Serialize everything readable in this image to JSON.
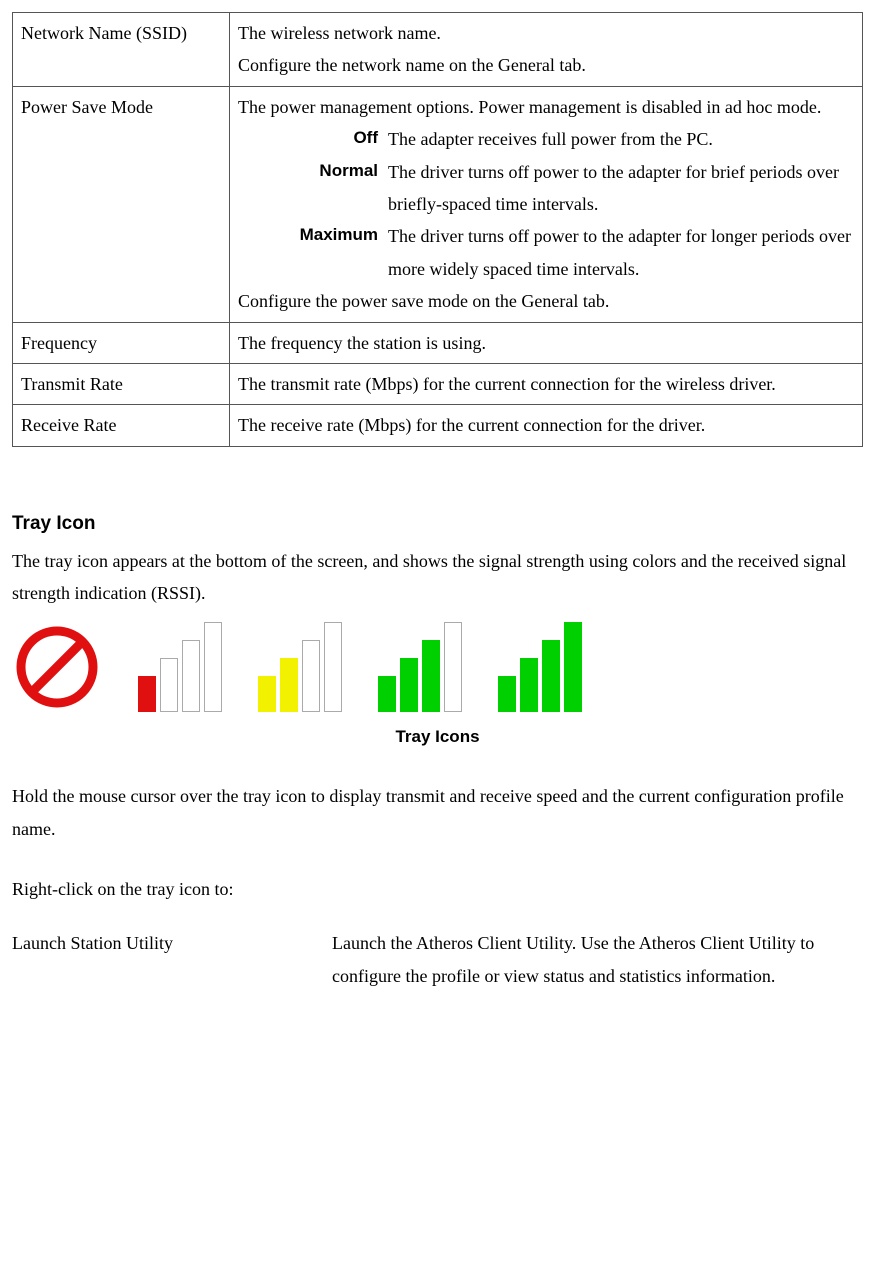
{
  "table": {
    "ssid": {
      "label": "Network Name (SSID)",
      "line1": "The wireless network name.",
      "line2": "Configure the network name on the General tab."
    },
    "power": {
      "label": "Power Save Mode",
      "intro": "The power management options. Power management is disabled in ad hoc mode.",
      "off_label": "Off",
      "off_desc": "The adapter receives full power from the PC.",
      "normal_label": "Normal",
      "normal_desc": "The driver turns off power to the adapter for brief periods over briefly-spaced time intervals.",
      "max_label": "Maximum",
      "max_desc": "The driver turns off power to the adapter for longer periods over more widely spaced time intervals.",
      "outro": "Configure the power save mode on the General tab."
    },
    "frequency": {
      "label": "Frequency",
      "desc": "The frequency the station is using."
    },
    "txrate": {
      "label": "Transmit Rate",
      "desc": "The transmit rate (Mbps) for the current connection for the wireless driver."
    },
    "rxrate": {
      "label": "Receive Rate",
      "desc": "The receive rate (Mbps) for the current connection for the driver."
    }
  },
  "tray": {
    "heading": "Tray Icon",
    "intro": "The tray icon appears at the bottom of the screen, and shows the signal strength using colors and the received signal strength indication (RSSI).",
    "caption": "Tray Icons",
    "hover": "Hold the mouse cursor over the tray icon to display transmit and receive speed and the current configuration profile name.",
    "right_click": "Right-click on the tray icon to:",
    "launch_label": "Launch Station Utility",
    "launch_desc": "Launch the Atheros Client Utility.  Use the Atheros Client Utility to configure the profile or view status and statistics information."
  }
}
